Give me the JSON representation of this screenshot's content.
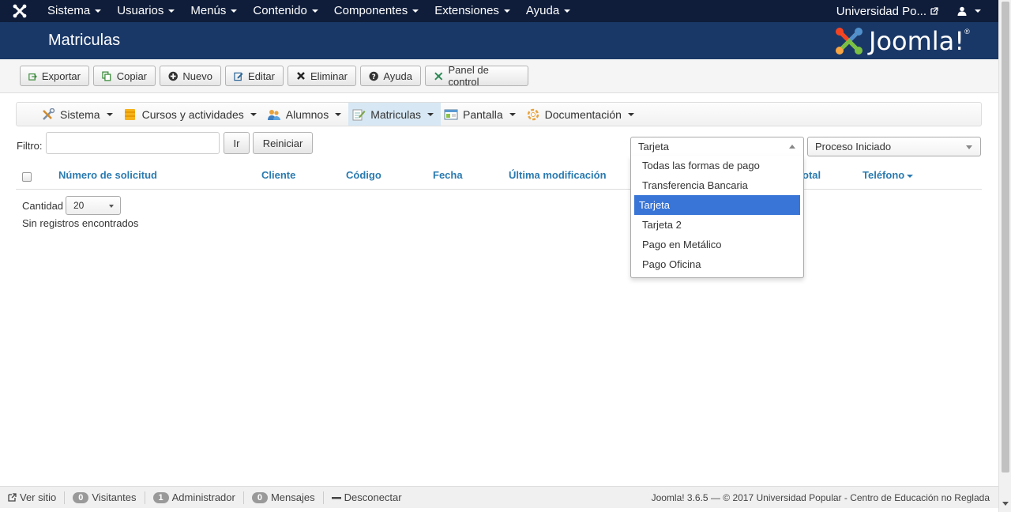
{
  "topnav": {
    "menu": [
      "Sistema",
      "Usuarios",
      "Menús",
      "Contenido",
      "Componentes",
      "Extensiones",
      "Ayuda"
    ],
    "site": "Universidad Po..."
  },
  "header": {
    "title": "Matriculas",
    "logo_text": "Joomla!",
    "logo_mark": "®"
  },
  "toolbar": {
    "export": "Exportar",
    "copy": "Copiar",
    "new": "Nuevo",
    "edit": "Editar",
    "delete": "Eliminar",
    "help": "Ayuda",
    "control_panel": "Panel de control"
  },
  "submenu": {
    "items": [
      "Sistema",
      "Cursos y actividades",
      "Alumnos",
      "Matriculas",
      "Pantalla",
      "Documentación"
    ],
    "active": "Matriculas"
  },
  "filter": {
    "label": "Filtro:",
    "value": "",
    "go": "Ir",
    "reset": "Reiniciar"
  },
  "payment_select": {
    "value": "Tarjeta",
    "options": [
      "Todas las formas de pago",
      "Transferencia Bancaria",
      "Tarjeta",
      "Tarjeta 2",
      "Pago en Metálico",
      "Pago Oficina"
    ],
    "selected_index": 2
  },
  "status_select": {
    "value": "Proceso Iniciado"
  },
  "table": {
    "columns": [
      "Número de solicitud",
      "Cliente",
      "Código",
      "Fecha",
      "Última modificación",
      "Total",
      "Teléfono"
    ],
    "visible_total_fragment": "otal"
  },
  "list": {
    "quantity_label": "Cantidad",
    "quantity_value": "20",
    "empty": "Sin registros encontrados"
  },
  "footer": {
    "view_site": "Ver sitio",
    "visitors_count": "0",
    "visitors": "Visitantes",
    "admin_count": "1",
    "admin": "Administrador",
    "messages_count": "0",
    "messages": "Mensajes",
    "logout": "Desconectar",
    "version": "Joomla! 3.6.5 — © 2017 Universidad Popular - Centro de Educación no Reglada"
  },
  "colors": {
    "topnav": "#0f1d3a",
    "header": "#1a3867",
    "link": "#2a7ab0",
    "selected": "#3875d7",
    "active_tab": "#d7e8f4"
  }
}
